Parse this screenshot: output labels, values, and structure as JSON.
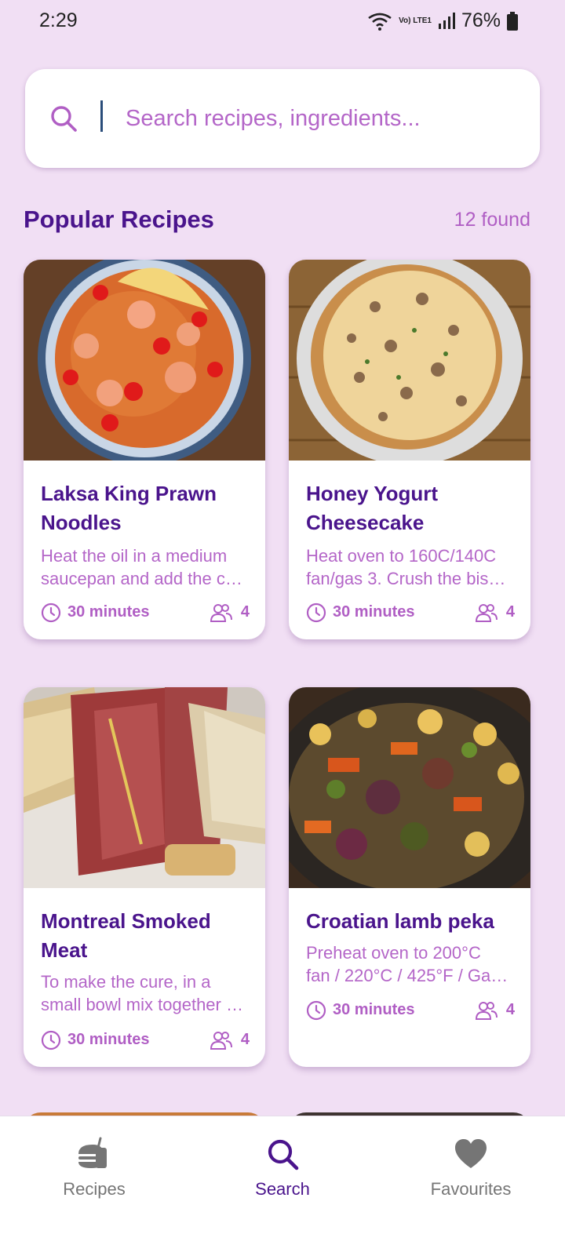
{
  "status_bar": {
    "time": "2:29",
    "network_label": "Vo) LTE1",
    "battery": "76%"
  },
  "search": {
    "placeholder": "Search recipes, ingredients...",
    "value": ""
  },
  "section": {
    "title": "Popular Recipes",
    "count": "12 found"
  },
  "recipes": [
    {
      "title_lines": [
        "Laksa King Prawn",
        "Noodles"
      ],
      "desc_lines": [
        "Heat the oil in a medium",
        "saucepan and add the c…"
      ],
      "time": "30 minutes",
      "servings": "4"
    },
    {
      "title_lines": [
        "Honey Yogurt",
        "Cheesecake"
      ],
      "desc_lines": [
        "Heat oven to 160C/140C",
        "fan/gas 3. Crush the bis…"
      ],
      "time": "30 minutes",
      "servings": "4"
    },
    {
      "title_lines": [
        "Montreal Smoked",
        "Meat"
      ],
      "desc_lines": [
        "To make the cure, in a",
        "small bowl mix together …"
      ],
      "time": "30 minutes",
      "servings": "4"
    },
    {
      "title_lines": [
        "Croatian lamb peka"
      ],
      "desc_lines": [
        "Preheat oven to 200°C",
        "fan / 220°C / 425°F / Ga…"
      ],
      "time": "30 minutes",
      "servings": "4"
    }
  ],
  "bottom_nav": {
    "items": [
      {
        "label": "Recipes",
        "icon": "burger-icon",
        "active": false
      },
      {
        "label": "Search",
        "icon": "search-icon",
        "active": true
      },
      {
        "label": "Favourites",
        "icon": "heart-icon",
        "active": false
      }
    ]
  },
  "colors": {
    "background": "#F1DFF4",
    "primary": "#4A148C",
    "accent": "#B05EC4",
    "inactive": "#757575"
  }
}
